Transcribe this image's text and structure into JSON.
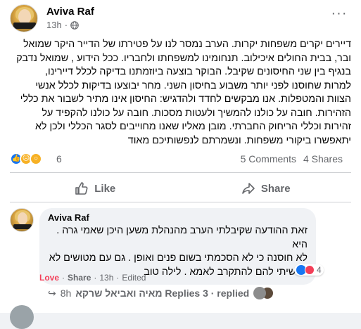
{
  "post": {
    "author": "Aviva Raf",
    "time": "13h",
    "body_lines": [
      "דיירים יקרים משפחות יקרות.  הערב נמסר לנו על פטירתו של הדייר היקר שמואל",
      "ובר, בבית החולים איכילוב. תנחומינו למשפחתו ולחבריו. ככל הידוע , שמואל נדבק",
      "בנגיף בין שני החיסונים שקיבל. הבוקר בוצעה  ביוזמתנו בדיקה לכלל דיירינו,",
      "למרות שחוסנו לפני יותר משבוע בחיסון השני. מחר יבוצעו בדיקות לכלל אנשי",
      "הצוות והמטפלות. אנו מבקשים לחדד ולהדגיש: החיסון אינו מתיר לשבור את כללי",
      "הזהירות. חובה על כולנו להמשיך ולעטות מסכות. חובה על כולנו להקפיד על",
      "זהירות וכללי הריחוק החברתי. מובן מאליו שאנו מחוייבים לסגר הכללי ולכן לא",
      "יתאפשרו ביקורי משפחות. ונשמרתם לנפשותיכם מאוד"
    ],
    "reaction_count": "6",
    "comments": "5 Comments",
    "shares": "4 Shares"
  },
  "actions": {
    "like_label": "Like",
    "share_label": "Share"
  },
  "comment": {
    "author": "Aviva Raf",
    "lines": [
      "זאת ההודעה שקיבלתי הערב מהנהלת משען היכן שאמי גרה . היא",
      "לא חוסנה כי לא הסכמתי בשום פנים ואופן . גם עם מטושים לא",
      "הרשיתי להם להתקרב לאמא . לילה טוב"
    ],
    "reaction_count": "4",
    "love_label": "Love",
    "share_label": "Share",
    "time": "13h",
    "edited": "Edited",
    "sep": "·"
  },
  "replies": {
    "time": "8h",
    "text": "Replies 3 · replied מאיה ואביאל שרקא"
  },
  "colors": {
    "brand": "#1877f2",
    "love": "#f33e58",
    "muted": "#65676b"
  }
}
